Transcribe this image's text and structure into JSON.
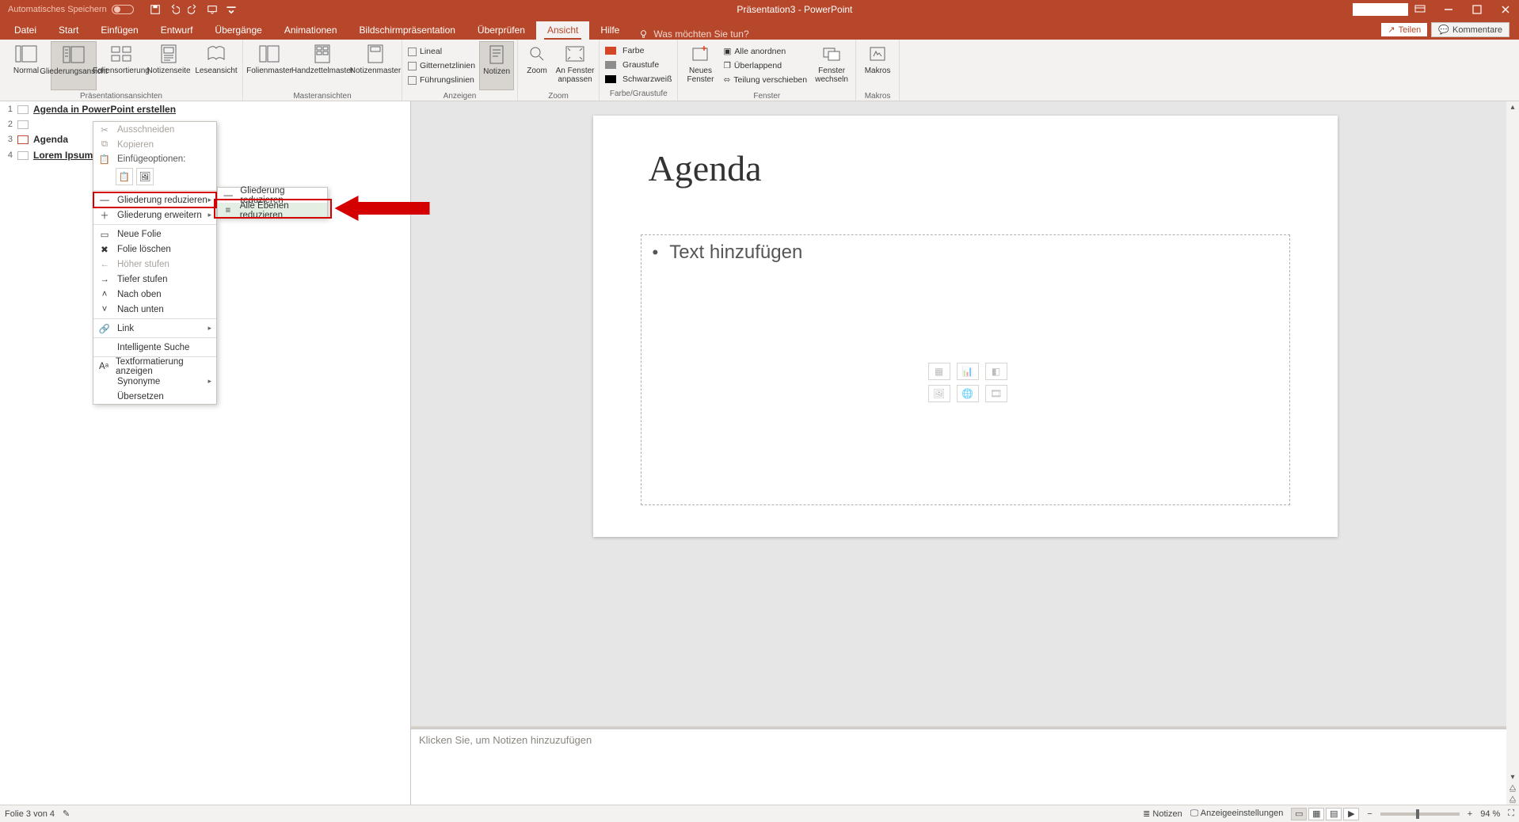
{
  "titlebar": {
    "autosave_label": "Automatisches Speichern",
    "title": "Präsentation3  -  PowerPoint"
  },
  "tabs": {
    "datei": "Datei",
    "start": "Start",
    "einfuegen": "Einfügen",
    "entwurf": "Entwurf",
    "uebergaenge": "Übergänge",
    "animationen": "Animationen",
    "bildschirm": "Bildschirmpräsentation",
    "ueberpruefen": "Überprüfen",
    "ansicht": "Ansicht",
    "hilfe": "Hilfe",
    "tellme": "Was möchten Sie tun?",
    "teilen": "Teilen",
    "kommentare": "Kommentare"
  },
  "ribbon": {
    "views": {
      "normal": "Normal",
      "gliederung": "Gliederungsansicht",
      "foliensort": "Foliensortierung",
      "notizenseite": "Notizenseite",
      "leseansicht": "Leseansicht",
      "group": "Präsentationsansichten"
    },
    "master": {
      "folienmaster": "Folienmaster",
      "handzettel": "Handzettelmaster",
      "notizenmaster": "Notizenmaster",
      "group": "Masteransichten"
    },
    "show": {
      "lineal": "Lineal",
      "gitter": "Gitternetzlinien",
      "fuehrung": "Führungslinien",
      "notizen": "Notizen",
      "group": "Anzeigen"
    },
    "zoom": {
      "zoom": "Zoom",
      "anfenster": "An Fenster anpassen",
      "group": "Zoom"
    },
    "color": {
      "farbe": "Farbe",
      "graustufe": "Graustufe",
      "schwarzweiss": "Schwarzweiß",
      "group": "Farbe/Graustufe"
    },
    "window": {
      "neues": "Neues Fenster",
      "alle": "Alle anordnen",
      "ueberlappend": "Überlappend",
      "teilung": "Teilung verschieben",
      "wechseln": "Fenster wechseln",
      "group": "Fenster"
    },
    "macros": {
      "makros": "Makros",
      "group": "Makros"
    }
  },
  "outline": {
    "items": [
      {
        "num": "1",
        "title": "Agenda in PowerPoint erstellen"
      },
      {
        "num": "2",
        "title": ""
      },
      {
        "num": "3",
        "title": "Agenda"
      },
      {
        "num": "4",
        "title": "Lorem Ipsum"
      }
    ]
  },
  "context_menu": {
    "ausschneiden": "Ausschneiden",
    "kopieren": "Kopieren",
    "einfuege_heading": "Einfügeoptionen:",
    "reduzieren": "Gliederung reduzieren",
    "erweitern": "Gliederung erweitern",
    "neue_folie": "Neue Folie",
    "folie_loeschen": "Folie löschen",
    "hoeher": "Höher stufen",
    "tiefer": "Tiefer stufen",
    "nach_oben": "Nach oben",
    "nach_unten": "Nach unten",
    "link": "Link",
    "intelligente": "Intelligente Suche",
    "textformat": "Textformatierung anzeigen",
    "synonyme": "Synonyme",
    "uebersetzen": "Übersetzen"
  },
  "submenu": {
    "reduzieren": "Gliederung reduzieren",
    "alle": "Alle Ebenen reduzieren"
  },
  "slide": {
    "title": "Agenda",
    "placeholder": "Text hinzufügen"
  },
  "notes": {
    "placeholder": "Klicken Sie, um Notizen hinzuzufügen"
  },
  "statusbar": {
    "slide_info": "Folie 3 von 4",
    "notizen": "Notizen",
    "anzeige": "Anzeigeeinstellungen",
    "zoom": "94 %"
  }
}
